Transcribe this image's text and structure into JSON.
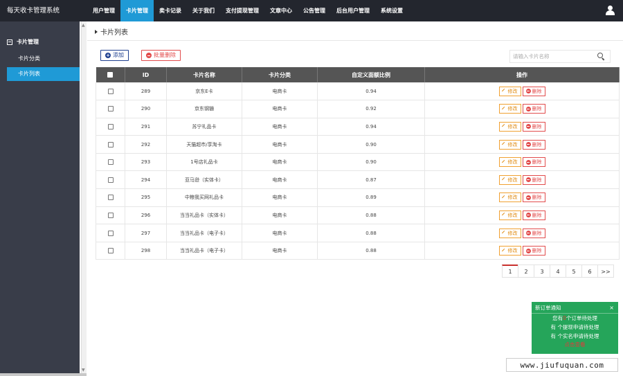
{
  "app": {
    "title": "每天收卡管理系统"
  },
  "nav": {
    "items": [
      "用户管理",
      "卡片管理",
      "卖卡记录",
      "关于我们",
      "支付提现管理",
      "文章中心",
      "公告管理",
      "后台用户管理",
      "系统设置"
    ],
    "active_index": 1
  },
  "sidebar": {
    "group": "卡片管理",
    "items": [
      {
        "label": "卡片分类",
        "active": false
      },
      {
        "label": "卡片列表",
        "active": true
      }
    ]
  },
  "breadcrumb": {
    "title": "卡片列表"
  },
  "toolbar": {
    "add_label": "添加",
    "batch_delete_label": "批量删除",
    "search_placeholder": "请输入卡片名称"
  },
  "table": {
    "headers": [
      "",
      "ID",
      "卡片名称",
      "卡片分类",
      "自定义面额比例",
      "操作"
    ],
    "edit_label": "修改",
    "delete_label": "删除",
    "rows": [
      {
        "id": "289",
        "name": "京东E卡",
        "category": "电商卡",
        "ratio": "0.94"
      },
      {
        "id": "290",
        "name": "京东钢镚",
        "category": "电商卡",
        "ratio": "0.92"
      },
      {
        "id": "291",
        "name": "苏宁礼品卡",
        "category": "电商卡",
        "ratio": "0.94"
      },
      {
        "id": "292",
        "name": "天猫超市/享淘卡",
        "category": "电商卡",
        "ratio": "0.90"
      },
      {
        "id": "293",
        "name": "1号店礼品卡",
        "category": "电商卡",
        "ratio": "0.90"
      },
      {
        "id": "294",
        "name": "亚马逊（实体卡）",
        "category": "电商卡",
        "ratio": "0.87"
      },
      {
        "id": "295",
        "name": "中粮我买网礼品卡",
        "category": "电商卡",
        "ratio": "0.89"
      },
      {
        "id": "296",
        "name": "当当礼品卡（实体卡）",
        "category": "电商卡",
        "ratio": "0.88"
      },
      {
        "id": "297",
        "name": "当当礼品卡（电子卡）",
        "category": "电商卡",
        "ratio": "0.88"
      },
      {
        "id": "298",
        "name": "当当礼品卡（电子卡）",
        "category": "电商卡",
        "ratio": "0.88"
      }
    ]
  },
  "pagination": {
    "pages": [
      "1",
      "2",
      "3",
      "4",
      "5",
      "6"
    ],
    "next": ">>",
    "current": "1"
  },
  "notification": {
    "title": "新订单通知",
    "close": "×",
    "line1_pre": "您有",
    "line1_num": "0",
    "line1_post": "个订单待处理",
    "line2_pre": "有",
    "line2_post": "个提现申请待处理",
    "line3_pre": "有",
    "line3_post": "个实名申请待处理",
    "link": "点击查看"
  },
  "watermark": "www.jiufuquan.com",
  "colors": {
    "topbar": "#23262e",
    "sidebar": "#393d49",
    "accent": "#1f9ad6",
    "table_header": "#555555",
    "notify": "#25a55a",
    "danger": "#e24b4b",
    "warn": "#f0a030"
  }
}
